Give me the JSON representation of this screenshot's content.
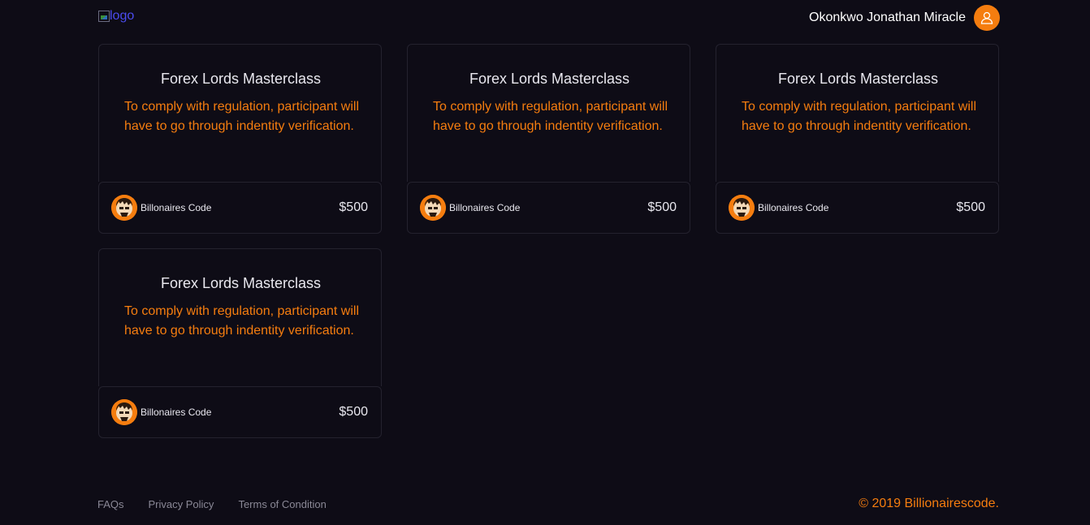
{
  "header": {
    "logo_alt": "logo",
    "user_name": "Okonkwo Jonathan Miracle",
    "user_icon": "user-icon"
  },
  "courses": [
    {
      "title": "Forex Lords Masterclass",
      "description": "To comply with regulation, participant will have to go through indentity verification.",
      "author": "Billonaires Code",
      "price": "$500"
    },
    {
      "title": "Forex Lords Masterclass",
      "description": "To comply with regulation, participant will have to go through indentity verification.",
      "author": "Billonaires Code",
      "price": "$500"
    },
    {
      "title": "Forex Lords Masterclass",
      "description": "To comply with regulation, participant will have to go through indentity verification.",
      "author": "Billonaires Code",
      "price": "$500"
    },
    {
      "title": "Forex Lords Masterclass",
      "description": "To comply with regulation, participant will have to go through indentity verification.",
      "author": "Billonaires Code",
      "price": "$500"
    }
  ],
  "footer": {
    "links": [
      "FAQs",
      "Privacy Policy",
      "Terms of Condition"
    ],
    "copyright": "© 2019 Billionairescode."
  },
  "colors": {
    "background": "#0e0c16",
    "accent": "#f57d0f",
    "text": "#e9e8ef",
    "muted": "#8a8896"
  }
}
